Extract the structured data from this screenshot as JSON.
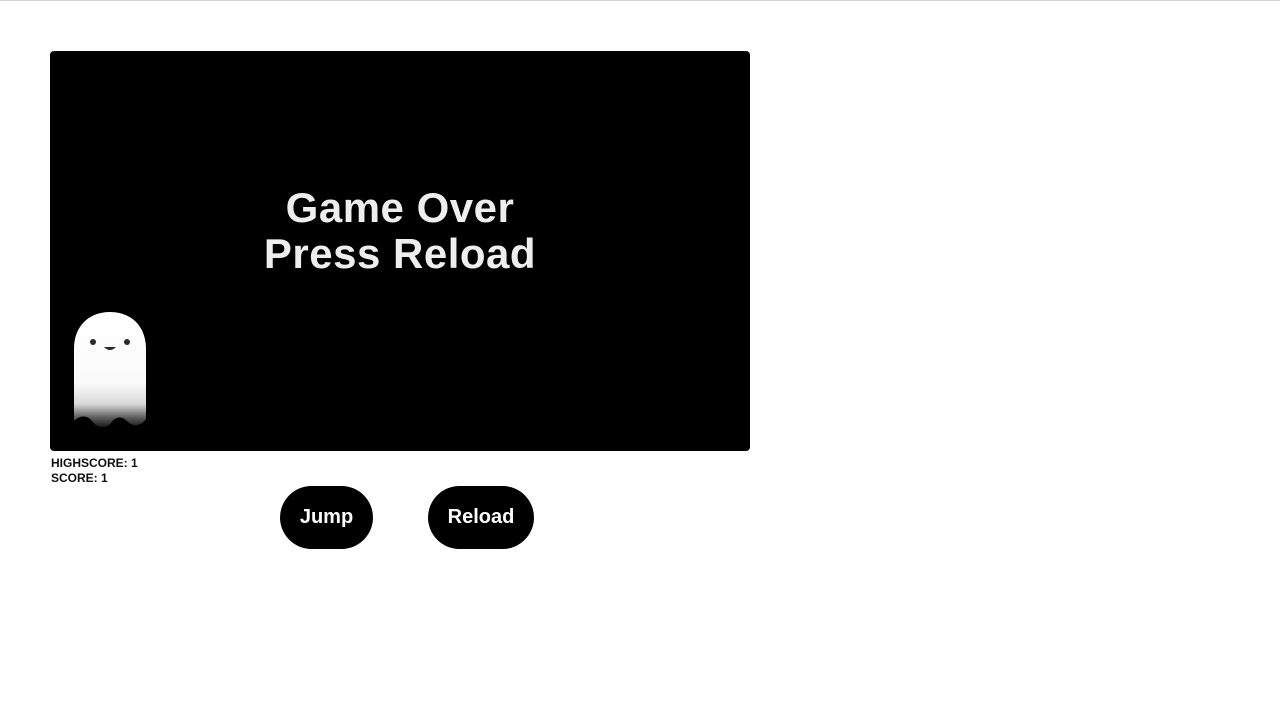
{
  "game": {
    "overlay_line1": "Game Over",
    "overlay_line2": "Press Reload",
    "character_icon": "ghost-icon",
    "canvas_color": "#000000",
    "overlay_text_color": "#eeeeee"
  },
  "score": {
    "highscore_text": "HIGHSCORE: 1",
    "score_text": "SCORE: 1"
  },
  "controls": {
    "jump_label": "Jump",
    "reload_label": "Reload",
    "button_color": "#000000",
    "button_text_color": "#ffffff"
  }
}
